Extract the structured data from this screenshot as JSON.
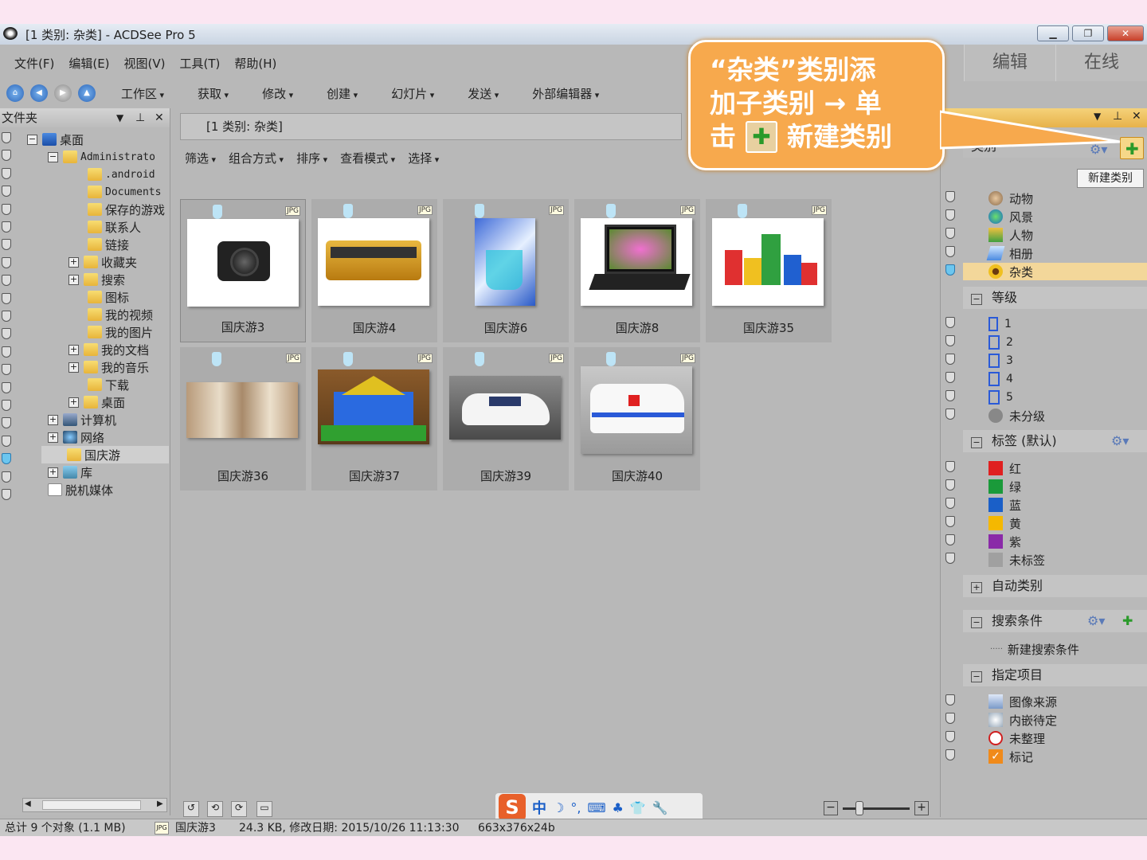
{
  "window": {
    "title": "[1 类别: 杂类] - ACDSee Pro 5"
  },
  "menu": {
    "items": [
      "文件(F)",
      "编辑(E)",
      "视图(V)",
      "工具(T)",
      "帮助(H)"
    ]
  },
  "mode_tabs": [
    "编辑",
    "在线"
  ],
  "toolbar": {
    "items": [
      "工作区",
      "获取",
      "修改",
      "创建",
      "幻灯片",
      "发送",
      "外部编辑器"
    ]
  },
  "folders": {
    "header": "文件夹",
    "items": [
      "桌面",
      "Administrato",
      ".android",
      "Documents",
      "保存的游戏",
      "联系人",
      "链接",
      "收藏夹",
      "搜索",
      "图标",
      "我的视频",
      "我的图片",
      "我的文档",
      "我的音乐",
      "下载",
      "桌面",
      "计算机",
      "网络",
      "国庆游",
      "库",
      "脱机媒体"
    ]
  },
  "path": "[1 类别: 杂类]",
  "filterbar": [
    "筛选",
    "组合方式",
    "排序",
    "查看模式",
    "选择"
  ],
  "thumbnails": [
    "国庆游3",
    "国庆游4",
    "国庆游6",
    "国庆游8",
    "国庆游35",
    "国庆游36",
    "国庆游37",
    "国庆游39",
    "国庆游40"
  ],
  "thumb_badge": "JPG",
  "categories": {
    "section": "类别",
    "items": [
      "动物",
      "风景",
      "人物",
      "相册",
      "杂类"
    ],
    "new_category_tooltip": "新建类别"
  },
  "ratings": {
    "section": "等级",
    "items": [
      "1",
      "2",
      "3",
      "4",
      "5",
      "未分级"
    ]
  },
  "labels": {
    "section": "标签 (默认)",
    "items": [
      {
        "name": "红",
        "color": "#e02020"
      },
      {
        "name": "绿",
        "color": "#1a9a3a"
      },
      {
        "name": "蓝",
        "color": "#1a5fc8"
      },
      {
        "name": "黄",
        "color": "#f5b800"
      },
      {
        "name": "紫",
        "color": "#8a2aa8"
      },
      {
        "name": "未标签",
        "color": "#a0a0a0"
      }
    ]
  },
  "auto_categories": {
    "section": "自动类别"
  },
  "search": {
    "section": "搜索条件",
    "new": "新建搜索条件"
  },
  "special": {
    "section": "指定项目",
    "items": [
      "图像来源",
      "内嵌待定",
      "未整理",
      "标记"
    ]
  },
  "status": {
    "count": "总计 9 个对象 (1.1 MB)",
    "file": "国庆游3",
    "info": "24.3 KB, 修改日期: 2015/10/26 11:13:30",
    "dims": "663x376x24b"
  },
  "ime": {
    "items": [
      "中",
      "☽",
      "°,",
      "⌨",
      "♣",
      "👕",
      "🔧"
    ]
  },
  "callout": {
    "line1": "“杂类”类别添",
    "line2": "加子类别 → 单",
    "line3_a": "击",
    "line3_b": "新建类别"
  }
}
